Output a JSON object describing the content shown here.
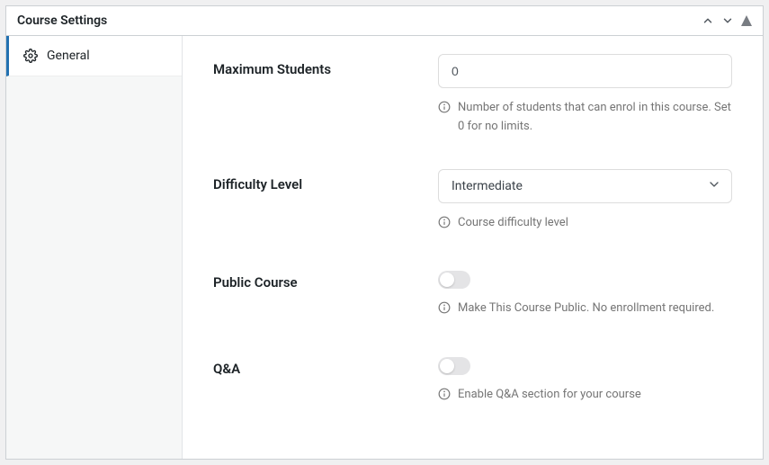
{
  "panel": {
    "title": "Course Settings"
  },
  "sidebar": {
    "items": [
      {
        "label": "General"
      }
    ]
  },
  "fields": {
    "max_students": {
      "label": "Maximum Students",
      "value": "0",
      "help": "Number of students that can enrol in this course. Set 0 for no limits."
    },
    "difficulty": {
      "label": "Difficulty Level",
      "value": "Intermediate",
      "help": "Course difficulty level"
    },
    "public_course": {
      "label": "Public Course",
      "on": false,
      "help": "Make This Course Public. No enrollment required."
    },
    "qa": {
      "label": "Q&A",
      "on": false,
      "help": "Enable Q&A section for your course"
    }
  }
}
